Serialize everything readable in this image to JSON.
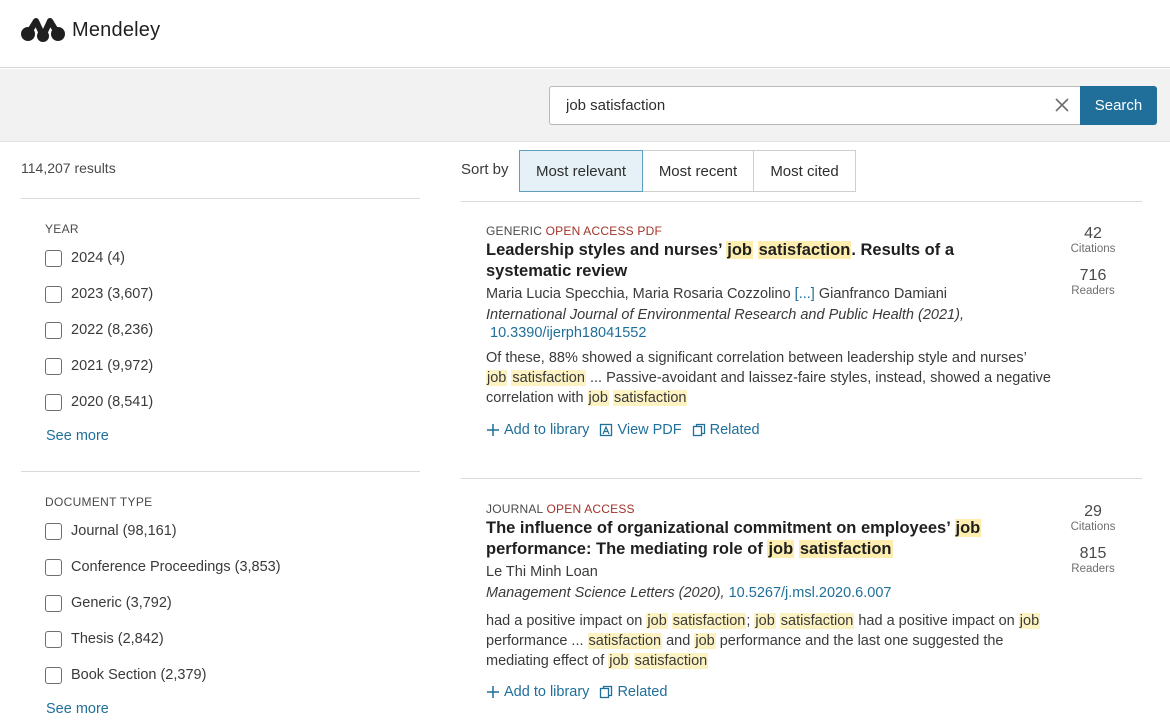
{
  "app": {
    "name": "Mendeley"
  },
  "search": {
    "query": "job satisfaction",
    "button_label": "Search"
  },
  "results": {
    "count_label": "114,207 results"
  },
  "sort": {
    "label": "Sort by",
    "options": [
      "Most relevant",
      "Most recent",
      "Most cited"
    ],
    "active": "Most relevant"
  },
  "facets": {
    "year": {
      "title": "YEAR",
      "items": [
        "2024 (4)",
        "2023 (3,607)",
        "2022 (8,236)",
        "2021 (9,972)",
        "2020 (8,541)"
      ],
      "see_more": "See more"
    },
    "doctype": {
      "title": "DOCUMENT TYPE",
      "items": [
        "Journal (98,161)",
        "Conference Proceedings (3,853)",
        "Generic (3,792)",
        "Thesis (2,842)",
        "Book Section (2,379)"
      ],
      "see_more": "See more"
    }
  },
  "items": [
    {
      "type": "GENERIC",
      "open_access": "OPEN ACCESS",
      "pdf": "PDF",
      "title_parts": [
        {
          "t": "Leadership styles and nurses’ ",
          "h": false
        },
        {
          "t": "job",
          "h": true
        },
        {
          "t": " ",
          "h": false
        },
        {
          "t": "satisfaction",
          "h": true
        },
        {
          "t": ". Results of a systematic review",
          "h": false
        }
      ],
      "authors": "Maria Lucia Specchia, Maria Rosaria Cozzolino",
      "authors_ellipsis": "[...]",
      "authors_last": "Gianfranco Damiani",
      "journal": "International Journal of Environmental Research and Public Health (2021),",
      "doi": "10.3390/ijerph18041552",
      "snippet_parts": [
        {
          "t": "Of these, 88% showed a significant correlation between leadership style and nurses’ ",
          "h": false
        },
        {
          "t": "job",
          "h": true
        },
        {
          "t": " ",
          "h": false
        },
        {
          "t": "satisfaction",
          "h": true
        },
        {
          "t": " ... Passive-avoidant and laissez-faire styles, instead, showed a negative correlation with ",
          "h": false
        },
        {
          "t": "job",
          "h": true
        },
        {
          "t": " ",
          "h": false
        },
        {
          "t": "satisfaction",
          "h": true
        }
      ],
      "actions": [
        "Add to library",
        "View PDF",
        "Related"
      ],
      "citations": "42",
      "citations_label": "Citations",
      "readers": "716",
      "readers_label": "Readers"
    },
    {
      "type": "JOURNAL",
      "open_access": "OPEN ACCESS",
      "title_parts": [
        {
          "t": "The influence of organizational commitment on employees’ ",
          "h": false
        },
        {
          "t": "job",
          "h": true
        },
        {
          "t": " performance: The mediating role of ",
          "h": false
        },
        {
          "t": "job",
          "h": true
        },
        {
          "t": " ",
          "h": false
        },
        {
          "t": "satisfaction",
          "h": true
        }
      ],
      "authors": "Le Thi Minh Loan",
      "journal": "Management Science Letters (2020),",
      "doi": "10.5267/j.msl.2020.6.007",
      "snippet_parts": [
        {
          "t": "had a positive impact on ",
          "h": false
        },
        {
          "t": "job",
          "h": true
        },
        {
          "t": " ",
          "h": false
        },
        {
          "t": "satisfaction",
          "h": true
        },
        {
          "t": "; ",
          "h": false
        },
        {
          "t": "job",
          "h": true
        },
        {
          "t": " ",
          "h": false
        },
        {
          "t": "satisfaction",
          "h": true
        },
        {
          "t": " had a positive impact on ",
          "h": false
        },
        {
          "t": "job",
          "h": true
        },
        {
          "t": " performance ... ",
          "h": false
        },
        {
          "t": "satisfaction",
          "h": true
        },
        {
          "t": " and ",
          "h": false
        },
        {
          "t": "job",
          "h": true
        },
        {
          "t": " performance and the last one suggested the mediating effect of ",
          "h": false
        },
        {
          "t": "job",
          "h": true
        },
        {
          "t": " ",
          "h": false
        },
        {
          "t": "satisfaction",
          "h": true
        }
      ],
      "actions": [
        "Add to library",
        "Related"
      ],
      "citations": "29",
      "citations_label": "Citations",
      "readers": "815",
      "readers_label": "Readers"
    }
  ],
  "icons": {
    "logo": "mendeley-logo-icon",
    "clear": "close-icon",
    "add": "plus-icon",
    "pdf": "pdf-icon",
    "related": "related-icon"
  },
  "colors": {
    "accent": "#1f6f9a",
    "open_access": "#a3332a",
    "highlight": "#fdf2c2"
  }
}
